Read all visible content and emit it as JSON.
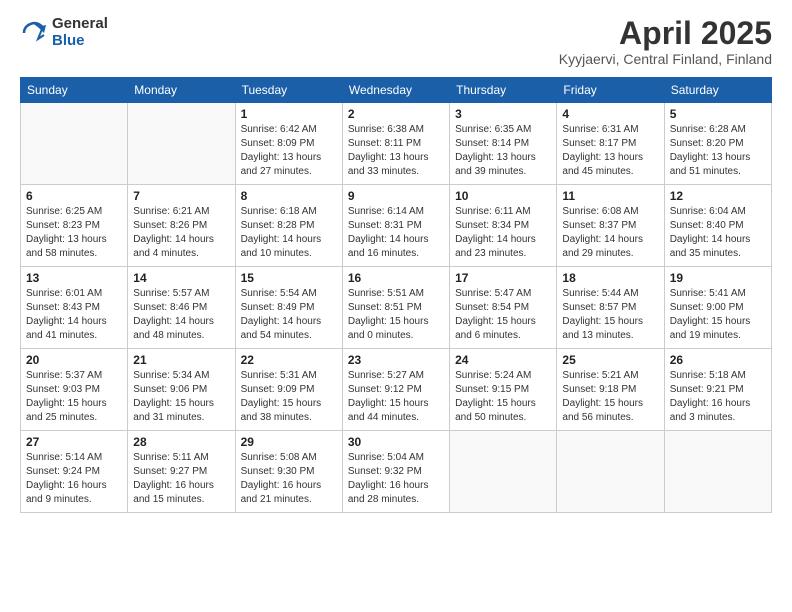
{
  "header": {
    "logo_general": "General",
    "logo_blue": "Blue",
    "title": "April 2025",
    "subtitle": "Kyyjaervi, Central Finland, Finland"
  },
  "weekdays": [
    "Sunday",
    "Monday",
    "Tuesday",
    "Wednesday",
    "Thursday",
    "Friday",
    "Saturday"
  ],
  "weeks": [
    [
      {
        "day": "",
        "info": ""
      },
      {
        "day": "",
        "info": ""
      },
      {
        "day": "1",
        "info": "Sunrise: 6:42 AM\nSunset: 8:09 PM\nDaylight: 13 hours\nand 27 minutes."
      },
      {
        "day": "2",
        "info": "Sunrise: 6:38 AM\nSunset: 8:11 PM\nDaylight: 13 hours\nand 33 minutes."
      },
      {
        "day": "3",
        "info": "Sunrise: 6:35 AM\nSunset: 8:14 PM\nDaylight: 13 hours\nand 39 minutes."
      },
      {
        "day": "4",
        "info": "Sunrise: 6:31 AM\nSunset: 8:17 PM\nDaylight: 13 hours\nand 45 minutes."
      },
      {
        "day": "5",
        "info": "Sunrise: 6:28 AM\nSunset: 8:20 PM\nDaylight: 13 hours\nand 51 minutes."
      }
    ],
    [
      {
        "day": "6",
        "info": "Sunrise: 6:25 AM\nSunset: 8:23 PM\nDaylight: 13 hours\nand 58 minutes."
      },
      {
        "day": "7",
        "info": "Sunrise: 6:21 AM\nSunset: 8:26 PM\nDaylight: 14 hours\nand 4 minutes."
      },
      {
        "day": "8",
        "info": "Sunrise: 6:18 AM\nSunset: 8:28 PM\nDaylight: 14 hours\nand 10 minutes."
      },
      {
        "day": "9",
        "info": "Sunrise: 6:14 AM\nSunset: 8:31 PM\nDaylight: 14 hours\nand 16 minutes."
      },
      {
        "day": "10",
        "info": "Sunrise: 6:11 AM\nSunset: 8:34 PM\nDaylight: 14 hours\nand 23 minutes."
      },
      {
        "day": "11",
        "info": "Sunrise: 6:08 AM\nSunset: 8:37 PM\nDaylight: 14 hours\nand 29 minutes."
      },
      {
        "day": "12",
        "info": "Sunrise: 6:04 AM\nSunset: 8:40 PM\nDaylight: 14 hours\nand 35 minutes."
      }
    ],
    [
      {
        "day": "13",
        "info": "Sunrise: 6:01 AM\nSunset: 8:43 PM\nDaylight: 14 hours\nand 41 minutes."
      },
      {
        "day": "14",
        "info": "Sunrise: 5:57 AM\nSunset: 8:46 PM\nDaylight: 14 hours\nand 48 minutes."
      },
      {
        "day": "15",
        "info": "Sunrise: 5:54 AM\nSunset: 8:49 PM\nDaylight: 14 hours\nand 54 minutes."
      },
      {
        "day": "16",
        "info": "Sunrise: 5:51 AM\nSunset: 8:51 PM\nDaylight: 15 hours\nand 0 minutes."
      },
      {
        "day": "17",
        "info": "Sunrise: 5:47 AM\nSunset: 8:54 PM\nDaylight: 15 hours\nand 6 minutes."
      },
      {
        "day": "18",
        "info": "Sunrise: 5:44 AM\nSunset: 8:57 PM\nDaylight: 15 hours\nand 13 minutes."
      },
      {
        "day": "19",
        "info": "Sunrise: 5:41 AM\nSunset: 9:00 PM\nDaylight: 15 hours\nand 19 minutes."
      }
    ],
    [
      {
        "day": "20",
        "info": "Sunrise: 5:37 AM\nSunset: 9:03 PM\nDaylight: 15 hours\nand 25 minutes."
      },
      {
        "day": "21",
        "info": "Sunrise: 5:34 AM\nSunset: 9:06 PM\nDaylight: 15 hours\nand 31 minutes."
      },
      {
        "day": "22",
        "info": "Sunrise: 5:31 AM\nSunset: 9:09 PM\nDaylight: 15 hours\nand 38 minutes."
      },
      {
        "day": "23",
        "info": "Sunrise: 5:27 AM\nSunset: 9:12 PM\nDaylight: 15 hours\nand 44 minutes."
      },
      {
        "day": "24",
        "info": "Sunrise: 5:24 AM\nSunset: 9:15 PM\nDaylight: 15 hours\nand 50 minutes."
      },
      {
        "day": "25",
        "info": "Sunrise: 5:21 AM\nSunset: 9:18 PM\nDaylight: 15 hours\nand 56 minutes."
      },
      {
        "day": "26",
        "info": "Sunrise: 5:18 AM\nSunset: 9:21 PM\nDaylight: 16 hours\nand 3 minutes."
      }
    ],
    [
      {
        "day": "27",
        "info": "Sunrise: 5:14 AM\nSunset: 9:24 PM\nDaylight: 16 hours\nand 9 minutes."
      },
      {
        "day": "28",
        "info": "Sunrise: 5:11 AM\nSunset: 9:27 PM\nDaylight: 16 hours\nand 15 minutes."
      },
      {
        "day": "29",
        "info": "Sunrise: 5:08 AM\nSunset: 9:30 PM\nDaylight: 16 hours\nand 21 minutes."
      },
      {
        "day": "30",
        "info": "Sunrise: 5:04 AM\nSunset: 9:32 PM\nDaylight: 16 hours\nand 28 minutes."
      },
      {
        "day": "",
        "info": ""
      },
      {
        "day": "",
        "info": ""
      },
      {
        "day": "",
        "info": ""
      }
    ]
  ]
}
